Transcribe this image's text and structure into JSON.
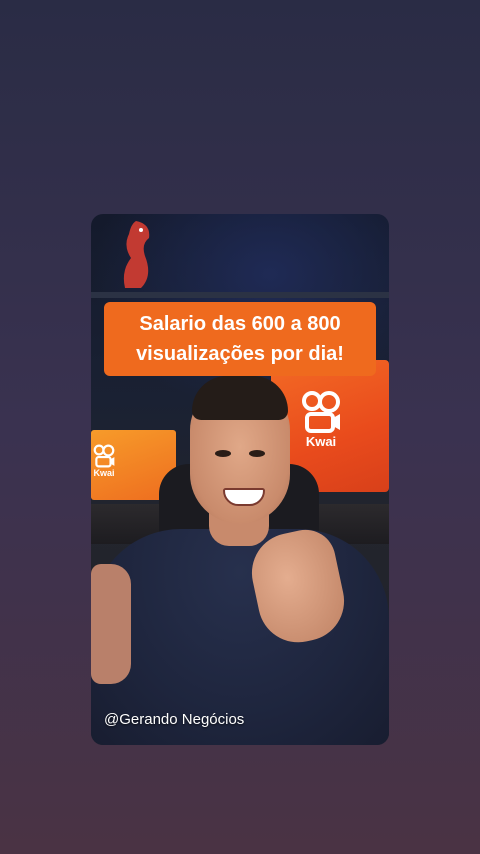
{
  "story": {
    "caption": "Salario das 600 a 800 visualizações por dia!",
    "handle": "@Gerando Negócios",
    "monitor_brand": "Kwai",
    "monitor_brand_small": "Kwai"
  },
  "colors": {
    "caption_bg": "#ef6a1e",
    "kwai_orange": "#f36a25",
    "page_bg_top": "#2a2c45",
    "page_bg_bottom": "#4a3344"
  },
  "icons": [
    "kwai-camera-logo-icon"
  ]
}
